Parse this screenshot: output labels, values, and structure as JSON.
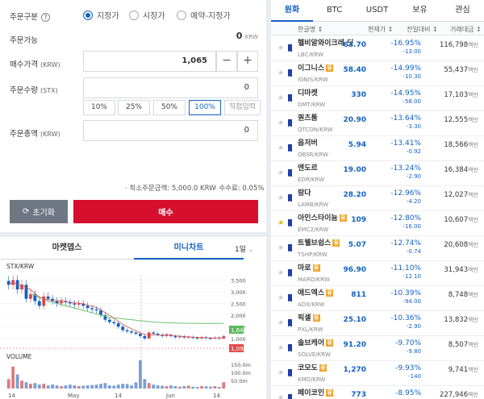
{
  "order": {
    "type_label": "주문구분",
    "help_icon": "?",
    "order_types": [
      {
        "label": "지정가",
        "selected": true
      },
      {
        "label": "시장가",
        "selected": false
      },
      {
        "label": "예약-지정가",
        "selected": false
      }
    ],
    "available_label": "주문가능",
    "available_value": "0",
    "available_unit": "KRW",
    "price_label": "매수가격",
    "price_unit": "(KRW)",
    "price_value": "1,065",
    "minus": "−",
    "plus": "+",
    "qty_label": "주문수량",
    "qty_unit": "(STX)",
    "qty_value": "0",
    "percents": [
      "10%",
      "25%",
      "50%",
      "100%"
    ],
    "direct_input": "직접입력",
    "total_label": "주문총액",
    "total_unit": "(KRW)",
    "total_value": "0",
    "min_order": "· 최소주문금액: 5,000.0 KRW",
    "fee": "· 수수료: 0.05%",
    "reset_button": "초기화",
    "buy_button": "매수"
  },
  "chart": {
    "tab_depth": "마켓뎁스",
    "tab_mini": "미니차트",
    "period": "1일",
    "series_label": "STX/KRW",
    "volume_label": "VOLUME",
    "price_ticks": [
      "3,500",
      "3,000",
      "2,500",
      "2,000",
      "1,500",
      "1,000",
      "500"
    ],
    "volume_ticks": [
      "150.0m",
      "100.0m",
      "50.0m"
    ],
    "x_ticks": [
      "14",
      "May",
      "14",
      "Jun",
      "14"
    ],
    "ma_last": "1,641",
    "price_last": "1,090"
  },
  "chart_data": {
    "type": "candlestick",
    "title": "STX/KRW",
    "ylim": [
      300,
      3900
    ],
    "close": [
      3300,
      3500,
      3100,
      3300,
      2700,
      2900,
      2600,
      2400,
      2800,
      2700,
      2600,
      2500,
      2600,
      2550,
      2500,
      2450,
      2500,
      2400,
      2300,
      2250,
      2200,
      2000,
      1800,
      1700,
      1650,
      1500,
      1350,
      1300,
      1250,
      1200,
      1100,
      1000,
      1250,
      1200,
      1150,
      1100,
      1150,
      1100,
      1050,
      1080,
      1040,
      1060,
      1020,
      1000,
      1050,
      1010,
      1000,
      1030,
      1000,
      1090
    ],
    "ma": [
      null,
      null,
      null,
      null,
      null,
      2900,
      2850,
      2750,
      2700,
      2600,
      2550,
      2500,
      2450,
      2400,
      2350,
      2300,
      2250,
      2200,
      2150,
      2100,
      2050,
      2000,
      1950,
      1900,
      1880,
      1860,
      1840,
      1820,
      1800,
      1780,
      1760,
      1740,
      1720,
      1700,
      1690,
      1680,
      1670,
      1665,
      1660,
      1655,
      1650,
      1648,
      1646,
      1644,
      1643,
      1642,
      1641,
      1641,
      1641,
      1641
    ],
    "volume": [
      60,
      140,
      90,
      50,
      40,
      30,
      35,
      25,
      30,
      20,
      25,
      20,
      15,
      20,
      25,
      20,
      15,
      18,
      20,
      22,
      25,
      30,
      35,
      20,
      18,
      25,
      30,
      28,
      20,
      40,
      180,
      60,
      35,
      25,
      20,
      18,
      15,
      20,
      15,
      12,
      15,
      18,
      12,
      10,
      15,
      14,
      12,
      15,
      10,
      40
    ]
  },
  "coin_list": {
    "tabs": [
      "원화",
      "BTC",
      "USDT",
      "보유",
      "관심"
    ],
    "headers": {
      "name": "한글명 ↕",
      "price": "현재가 ↕",
      "rate": "전일대비 ↕",
      "volume": "거래대금 ↕"
    },
    "volume_unit": "백만",
    "warn_badge": "유",
    "rows": [
      {
        "name": "헬비알와이크레 딧",
        "symbol": "LBC/KRW",
        "price": "63.70",
        "rate": "-16.95%",
        "diff": "-13.00",
        "volume": "116,798",
        "fav": false,
        "warn": false
      },
      {
        "name": "이그니스",
        "symbol": "IGNIS/KRW",
        "price": "58.40",
        "rate": "-14.99%",
        "diff": "-10.30",
        "volume": "55,437",
        "fav": false,
        "warn": true
      },
      {
        "name": "디마켓",
        "symbol": "DMT/KRW",
        "price": "330",
        "rate": "-14.95%",
        "diff": "-58.00",
        "volume": "17,103",
        "fav": false,
        "warn": false
      },
      {
        "name": "퀀츠툼",
        "symbol": "QTCON/KRW",
        "price": "20.90",
        "rate": "-13.64%",
        "diff": "-3.30",
        "volume": "12,555",
        "fav": false,
        "warn": false
      },
      {
        "name": "옵저버",
        "symbol": "OBSR/KRW",
        "price": "5.94",
        "rate": "-13.41%",
        "diff": "-0.92",
        "volume": "18,566",
        "fav": false,
        "warn": false
      },
      {
        "name": "엔도르",
        "symbol": "EDR/KRW",
        "price": "19.00",
        "rate": "-13.24%",
        "diff": "-2.90",
        "volume": "16,384",
        "fav": false,
        "warn": false
      },
      {
        "name": "람다",
        "symbol": "LAMB/KRW",
        "price": "28.20",
        "rate": "-12.96%",
        "diff": "-4.20",
        "volume": "12,027",
        "fav": false,
        "warn": false
      },
      {
        "name": "아인스타이늄",
        "symbol": "EMC2/KRW",
        "price": "109",
        "rate": "-12.80%",
        "diff": "-16.00",
        "volume": "10,607",
        "fav": true,
        "warn": true
      },
      {
        "name": "트웰브쉽스",
        "symbol": "TSHP/KRW",
        "price": "5.07",
        "rate": "-12.74%",
        "diff": "-0.74",
        "volume": "20,608",
        "fav": false,
        "warn": true
      },
      {
        "name": "마로",
        "symbol": "MARO/KRW",
        "price": "96.90",
        "rate": "-11.10%",
        "diff": "-12.10",
        "volume": "31,943",
        "fav": false,
        "warn": true
      },
      {
        "name": "애드엑스",
        "symbol": "ADX/KRW",
        "price": "811",
        "rate": "-10.39%",
        "diff": "-94.00",
        "volume": "8,748",
        "fav": false,
        "warn": true
      },
      {
        "name": "픽셀",
        "symbol": "PXL/KRW",
        "price": "25.10",
        "rate": "-10.36%",
        "diff": "-2.90",
        "volume": "13,832",
        "fav": false,
        "warn": true
      },
      {
        "name": "솔브케어",
        "symbol": "SOLVE/KRW",
        "price": "91.20",
        "rate": "-9.70%",
        "diff": "-9.80",
        "volume": "8,507",
        "fav": false,
        "warn": true
      },
      {
        "name": "코모도",
        "symbol": "KMD/KRW",
        "price": "1,270",
        "rate": "-9.93%",
        "diff": "-140",
        "volume": "9,741",
        "fav": false,
        "warn": true
      },
      {
        "name": "페이코인",
        "symbol": "PCI/KRW",
        "price": "773",
        "rate": "-8.95%",
        "diff": "-76.00",
        "volume": "227,946",
        "fav": false,
        "warn": true
      }
    ]
  }
}
